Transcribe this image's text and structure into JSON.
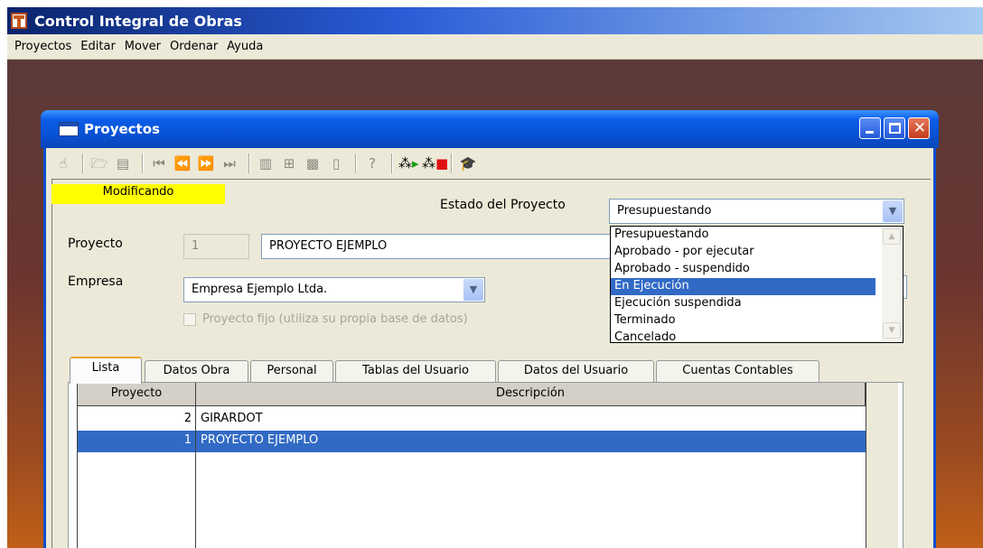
{
  "app": {
    "title": "Control Integral de Obras",
    "menu": [
      "Proyectos",
      "Editar",
      "Mover",
      "Ordenar",
      "Ayuda"
    ]
  },
  "window": {
    "title": "Proyectos"
  },
  "toolbar": {
    "icons": [
      "hand-icon",
      "open-folder-icon",
      "form-icon",
      "first-record-icon",
      "previous-record-icon",
      "next-record-icon",
      "last-record-icon",
      "new-record-icon",
      "tree-icon",
      "pattern-icon",
      "delete-icon",
      "help-icon",
      "run-green-icon",
      "stop-red-icon",
      "graduation-cap-icon"
    ]
  },
  "form": {
    "mode": "Modificando",
    "estado_label": "Estado del Proyecto",
    "estado_value": "Presupuestando",
    "proyecto_label": "Proyecto",
    "proyecto_id": "1",
    "proyecto_name": "PROYECTO EJEMPLO",
    "empresa_label": "Empresa",
    "empresa_value": "Empresa Ejemplo Ltda.",
    "fijo_label": "Proyecto fijo (utiliza su propia base de datos)"
  },
  "estado_options": [
    "Presupuestando",
    "Aprobado - por ejecutar",
    "Aprobado - suspendido",
    "En Ejecución",
    "Ejecución suspendida",
    "Terminado",
    "Cancelado"
  ],
  "estado_highlighted": "En Ejecución",
  "tabs": [
    "Lista",
    "Datos Obra",
    "Personal",
    "Tablas del Usuario",
    "Datos del Usuario",
    "Cuentas Contables"
  ],
  "active_tab": "Lista",
  "grid": {
    "columns": [
      "Proyecto",
      "Descripción"
    ],
    "rows": [
      {
        "id": "2",
        "desc": "GIRARDOT"
      },
      {
        "id": "1",
        "desc": "PROYECTO EJEMPLO"
      }
    ],
    "selected_row": 1
  },
  "colors": {
    "selection": "#316ac5",
    "status_tag": "#ffff00",
    "title_blue": "#0a5de8"
  }
}
